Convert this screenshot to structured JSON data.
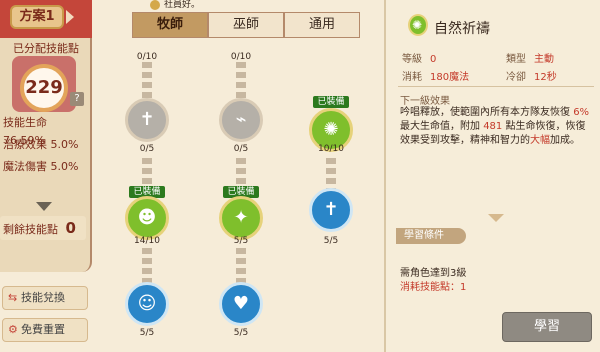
{
  "header": {
    "top_note": "社員好。"
  },
  "tabs": [
    {
      "label": "牧師",
      "active": true
    },
    {
      "label": "巫師",
      "active": false
    },
    {
      "label": "通用",
      "active": false
    }
  ],
  "left_panel": {
    "scheme_tag": "方案1",
    "allocated_label": "已分配技能點",
    "allocated_points": "229",
    "help_mark": "?",
    "stats": [
      {
        "label": "技能生命",
        "value": "76.59%"
      },
      {
        "label": "治療效果",
        "value": "5.0%"
      },
      {
        "label": "魔法傷害",
        "value": "5.0%"
      }
    ],
    "remaining_label": "剩餘技能點",
    "remaining_points": "0",
    "exchange_button": "技能兌換",
    "reset_button": "免費重置"
  },
  "tree": {
    "nodes": [
      {
        "id": "n1",
        "count": "0/10",
        "equipped": false
      },
      {
        "id": "n2",
        "count": "0/10",
        "equipped": false
      },
      {
        "id": "n3",
        "count": "0/5",
        "equipped": false,
        "icon": "cross-shield-icon"
      },
      {
        "id": "n4",
        "count": "0/5",
        "equipped": false,
        "icon": "tornado-icon"
      },
      {
        "id": "n5",
        "count": "10/10",
        "equipped": true,
        "badge": "已裝備",
        "icon": "green-burst-icon"
      },
      {
        "id": "n6",
        "count": "10/10",
        "equipped": true,
        "badge": "已裝備",
        "icon": "silhouette-icon"
      },
      {
        "id": "n7",
        "count": "14/10",
        "equipped": true,
        "badge": "已裝備",
        "icon": "wings-icon"
      },
      {
        "id": "n8",
        "count": "5/5",
        "equipped": false,
        "icon": "cross-runner-icon"
      },
      {
        "id": "n9",
        "count": "5/5",
        "equipped": false,
        "icon": "figure-icon"
      },
      {
        "id": "n10",
        "count": "5/5",
        "equipped": false,
        "icon": "hearts-icon"
      }
    ]
  },
  "skill": {
    "name": "自然祈禱",
    "level_label": "等級",
    "level_value": "0",
    "type_label": "類型",
    "type_value": "主動",
    "cost_label": "消耗",
    "cost_value": "180魔法",
    "cooldown_label": "冷卻",
    "cooldown_value": "12秒",
    "next_label": "下一級效果",
    "desc_1": "吟唱釋放，使範圍內所有本方隊友恢復",
    "desc_pct": "6%",
    "desc_2": "最大生命值，附加",
    "desc_hp": "481",
    "desc_3": "點生命恢復，恢復效果受到攻擊，精神和智力的",
    "desc_big": "大幅",
    "desc_4": "加成。",
    "req_label": "學習條件",
    "req_1": "需角色達到3級",
    "req_2": "消耗技能點：1",
    "learn_button": "學習"
  },
  "colors": {
    "accent": "#c4463a",
    "highlight": "#c43a2a"
  }
}
